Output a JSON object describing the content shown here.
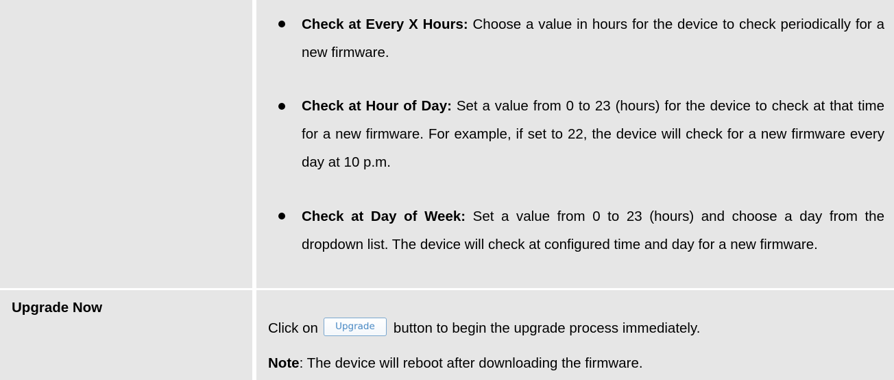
{
  "options": [
    {
      "term": "Check at Every X Hours:",
      "description": " Choose a value in hours for the device to check periodically for a new firmware."
    },
    {
      "term": "Check at Hour of Day:",
      "description": " Set a value from 0 to 23 (hours) for the device to check at that time for a new firmware. For example, if set to 22, the device will check for a new firmware every day at 10 p.m."
    },
    {
      "term": "Check at Day of Week:",
      "description": " Set a value from 0 to 23 (hours) and choose a day from the dropdown list. The device will check at configured time and day for a new firmware."
    }
  ],
  "upgrade_now": {
    "label": "Upgrade Now",
    "text_before": "Click on",
    "button_label": "Upgrade",
    "text_after": "button to begin the upgrade process immediately.",
    "note_label": "Note",
    "note_text": ": The device will reboot after downloading the firmware."
  },
  "colors": {
    "cell_background": "#e6e6e6",
    "button_border": "#7aa7cf",
    "button_text": "#4a8ac4"
  }
}
